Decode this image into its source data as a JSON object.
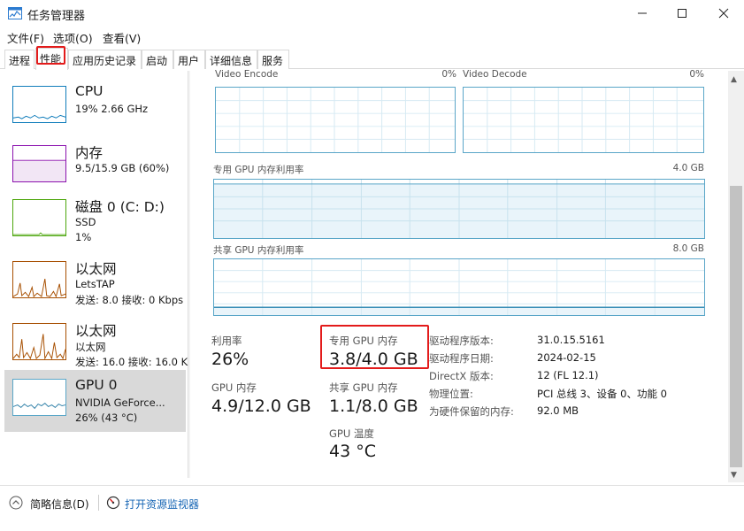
{
  "window": {
    "title": "任务管理器"
  },
  "menu": {
    "file": "文件(F)",
    "options": "选项(O)",
    "view": "查看(V)"
  },
  "tabs": [
    "进程",
    "性能",
    "应用历史记录",
    "启动",
    "用户",
    "详细信息",
    "服务"
  ],
  "sidebar": {
    "items": [
      {
        "name": "CPU",
        "line1": "19%  2.66 GHz",
        "line2": ""
      },
      {
        "name": "内存",
        "line1": "9.5/15.9 GB (60%)",
        "line2": ""
      },
      {
        "name": "磁盘 0 (C: D:)",
        "line1": "SSD",
        "line2": "1%"
      },
      {
        "name": "以太网",
        "line1": "LetsTAP",
        "line2": "发送: 8.0  接收: 0 Kbps"
      },
      {
        "name": "以太网",
        "line1": "以太网",
        "line2": "发送: 16.0  接收: 16.0 K"
      },
      {
        "name": "GPU 0",
        "line1": "NVIDIA GeForce...",
        "line2": "26% (43 °C)"
      }
    ]
  },
  "graphs": {
    "video_encode": {
      "label": "Video Encode",
      "max": "0%"
    },
    "video_decode": {
      "label": "Video Decode",
      "max": "0%"
    },
    "dedicated": {
      "label": "专用 GPU 内存利用率",
      "max": "4.0 GB"
    },
    "shared": {
      "label": "共享 GPU 内存利用率",
      "max": "8.0 GB"
    }
  },
  "stats": {
    "utilization": {
      "label": "利用率",
      "value": "26%"
    },
    "dedicated_mem": {
      "label": "专用 GPU 内存",
      "value": "3.8/4.0 GB"
    },
    "gpu_mem": {
      "label": "GPU 内存",
      "value": "4.9/12.0 GB"
    },
    "shared_mem": {
      "label": "共享 GPU 内存",
      "value": "1.1/8.0 GB"
    },
    "temperature": {
      "label": "GPU 温度",
      "value": "43 °C"
    }
  },
  "info": [
    {
      "label": "驱动程序版本:",
      "value": "31.0.15.5161"
    },
    {
      "label": "驱动程序日期:",
      "value": "2024-02-15"
    },
    {
      "label": "DirectX 版本:",
      "value": "12 (FL 12.1)"
    },
    {
      "label": "物理位置:",
      "value": "PCI 总线 3、设备 0、功能 0"
    },
    {
      "label": "为硬件保留的内存:",
      "value": "92.0 MB"
    }
  ],
  "footer": {
    "less_details": "简略信息(D)",
    "resource_monitor": "打开资源监视器"
  },
  "colors": {
    "cpu": "#117dbb",
    "memory": "#8b12ae",
    "disk": "#4da60c",
    "ethernet": "#a74f01",
    "gpu": "#5aa6c8",
    "highlight": "#e31b1b"
  }
}
